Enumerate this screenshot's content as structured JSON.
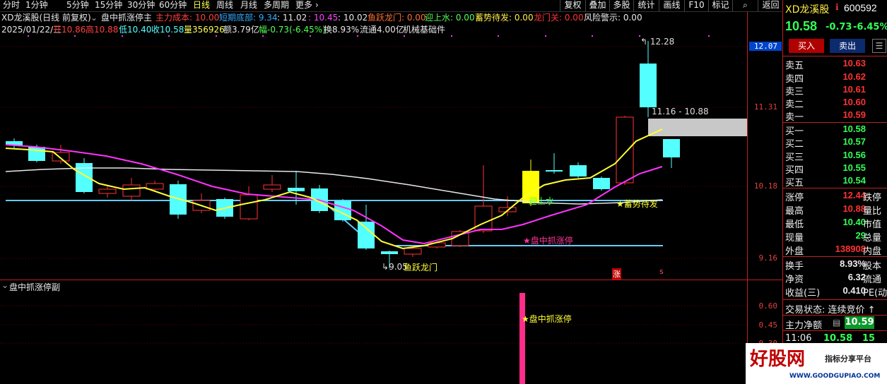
{
  "toolbar": {
    "tabs": [
      "分时",
      "1分钟",
      "5分钟",
      "15分钟",
      "30分钟",
      "60分钟",
      "日线",
      "周线",
      "月线",
      "多周期",
      "更多"
    ],
    "active_tab": "日线",
    "buttons": [
      "复权",
      "叠加",
      "多股",
      "统计",
      "画线",
      "F10",
      "标记",
      "返回"
    ]
  },
  "title_bar": {
    "stock": "XD龙溪股(日线 前复权)",
    "indicator": "盘中抓涨停主",
    "main_cost_label": "主力成本: 10.00",
    "short_bottom_label": "短期底部: 9.34",
    "v1": ": 11.02",
    "v2": ": 10.45",
    "v3": ": 10.02",
    "fish_label": "鱼跃龙门: 0.00",
    "welcome_label": "迎上水: 0.00",
    "accum_label": "蓄势待发: 0.00",
    "dragon_gate_label": "龙门关: 0.00",
    "risk_label": "风险警示: 0.00"
  },
  "info_bar": {
    "date": "2025/01/22/三",
    "open": "开10.86",
    "high": "高10.88",
    "low": "低10.40",
    "close": "收10.58",
    "volume": "量356926",
    "amount": "额3.79亿",
    "change": "幅-0.73(-6.45%)",
    "turnover": "换8.93%",
    "float_cap": "流通4.00亿",
    "sector": "机械基础件"
  },
  "main_chart": {
    "price_axis": [
      "12.07",
      "11.31",
      "10.18",
      "9.16"
    ],
    "high_label": "12.28",
    "range_label": "11.16 - 10.88",
    "low_label": "9.05",
    "signals": {
      "fish": "鱼跃龙门",
      "welcome": "迎上水",
      "accum": "★蓄势待发",
      "limit_up": "★盘中抓涨停",
      "zhang": "涨",
      "s": "s"
    }
  },
  "sub_chart": {
    "title": "盘中抓涨停副",
    "axis": [
      "0.60",
      "0.45",
      "0.30"
    ],
    "signal": "★盘中抓涨停"
  },
  "quote_panel": {
    "name": "XD龙溪股",
    "code": "600592",
    "price": "10.58",
    "change": "-0.73",
    "pct": "-6.45%",
    "buy_btn": "买入",
    "sell_btn": "卖出",
    "asks": [
      {
        "label": "卖五",
        "price": "10.63"
      },
      {
        "label": "卖四",
        "price": "10.62"
      },
      {
        "label": "卖三",
        "price": "10.61"
      },
      {
        "label": "卖二",
        "price": "10.60"
      },
      {
        "label": "卖一",
        "price": "10.59"
      }
    ],
    "bids": [
      {
        "label": "买一",
        "price": "10.58"
      },
      {
        "label": "买二",
        "price": "10.57"
      },
      {
        "label": "买三",
        "price": "10.56"
      },
      {
        "label": "买四",
        "price": "10.55"
      },
      {
        "label": "买五",
        "price": "10.54"
      }
    ],
    "stats": [
      {
        "label": "涨停",
        "value": "12.44",
        "label2": "跌停"
      },
      {
        "label": "最高",
        "value": "10.88",
        "label2": "量比"
      },
      {
        "label": "最低",
        "value": "10.40",
        "label2": "市值"
      },
      {
        "label": "现量",
        "value": "29",
        "label2": "总量"
      },
      {
        "label": "外盘",
        "value": "138908",
        "label2": "内盘"
      }
    ],
    "stats2": [
      {
        "label": "换手",
        "value": "8.93%",
        "label2": "股本"
      },
      {
        "label": "净资",
        "value": "6.32",
        "label2": "流通"
      },
      {
        "label": "收益(三)",
        "value": "0.410",
        "label2": "PE(动)"
      }
    ],
    "trade_status": "交易状态: 连续竞价 ↑",
    "main_net": "主力净额",
    "main_net_value": "10.59",
    "time": "11:06",
    "time_price": "10.58",
    "time_vol": "15"
  },
  "watermark": {
    "logo": "好股网",
    "tagline": "指标分享平台",
    "url": "WWW.GOODGUPIAO.COM"
  },
  "colors": {
    "up": "#ff3333",
    "down": "#54ffff",
    "ma_yellow": "#ffff00",
    "ma_magenta": "#ff33ff",
    "line_blue": "#55aaff"
  }
}
